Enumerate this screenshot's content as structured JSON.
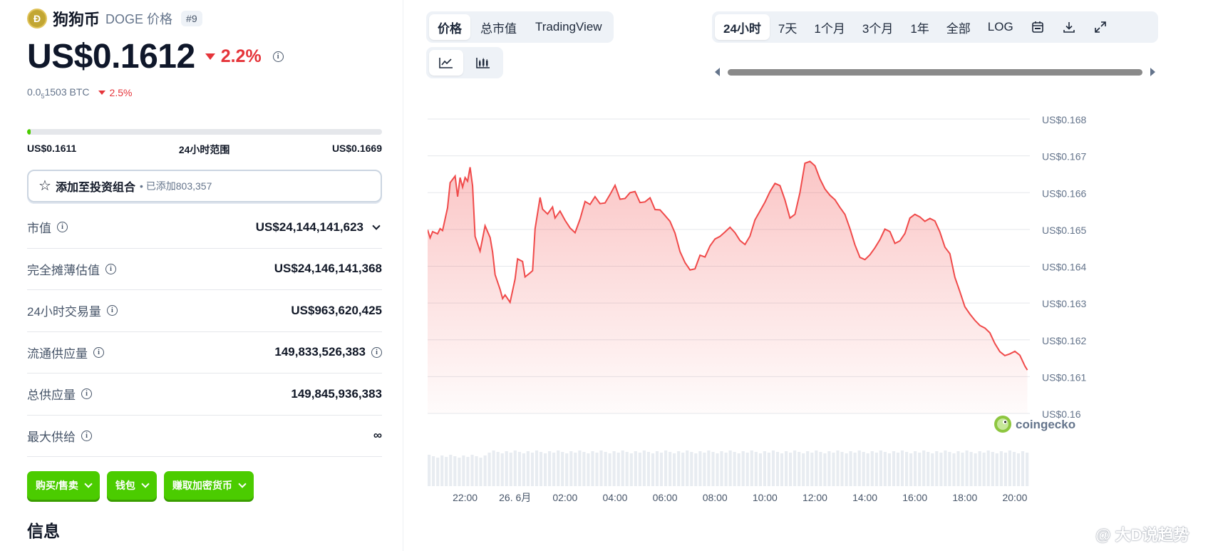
{
  "coin": {
    "name": "狗狗币",
    "symbol_label": "DOGE 价格",
    "rank": "#9",
    "price": "US$0.1612",
    "change_24h": "2.2%",
    "btc_prefix": "0.0",
    "btc_sub": "5",
    "btc_rest": "1503 BTC",
    "btc_change": "2.5%",
    "accent_color": "#4bcc00",
    "down_color": "#e5343a"
  },
  "range": {
    "low": "US$0.1611",
    "label": "24小时范围",
    "high": "US$0.1669",
    "position_fraction": 0.01
  },
  "portfolio": {
    "label": "添加至投资组合",
    "sub": "• 已添加803,357"
  },
  "stats": [
    {
      "label": "市值",
      "value": "US$24,144,141,623"
    },
    {
      "label": "完全摊薄估值",
      "value": "US$24,146,141,368"
    },
    {
      "label": "24小时交易量",
      "value": "US$963,620,425"
    },
    {
      "label": "流通供应量",
      "value": "149,833,526,383"
    },
    {
      "label": "总供应量",
      "value": "149,845,936,383"
    },
    {
      "label": "最大供给",
      "value": "∞"
    }
  ],
  "actions": [
    {
      "label": "购买/售卖"
    },
    {
      "label": "钱包"
    },
    {
      "label": "赚取加密货币"
    }
  ],
  "section_title": "信息",
  "view_tabs": [
    {
      "label": "价格",
      "active": true
    },
    {
      "label": "总市值",
      "active": false
    },
    {
      "label": "TradingView",
      "active": false
    }
  ],
  "chart_type_icons": [
    "line-chart-icon",
    "candlestick-chart-icon"
  ],
  "range_tabs": [
    {
      "label": "24小时",
      "active": true
    },
    {
      "label": "7天",
      "active": false
    },
    {
      "label": "1个月",
      "active": false
    },
    {
      "label": "3个月",
      "active": false
    },
    {
      "label": "1年",
      "active": false
    },
    {
      "label": "全部",
      "active": false
    },
    {
      "label": "LOG",
      "active": false
    }
  ],
  "toolbar_icons": [
    "calendar-icon",
    "download-icon",
    "fullscreen-icon"
  ],
  "watermark": "@ 大D说趋势",
  "chart_data": {
    "type": "area",
    "line_color": "#f04a4a",
    "brand_label": "coingecko",
    "y_ticks": [
      "US$0.168",
      "US$0.167",
      "US$0.166",
      "US$0.165",
      "US$0.164",
      "US$0.163",
      "US$0.162",
      "US$0.161",
      "US$0.16"
    ],
    "ylim": [
      0.16,
      0.168
    ],
    "x_ticks": [
      "22:00",
      "26. 6月",
      "02:00",
      "04:00",
      "06:00",
      "08:00",
      "10:00",
      "12:00",
      "14:00",
      "16:00",
      "18:00",
      "20:00"
    ],
    "x_tick_hours": [
      22,
      24,
      26,
      28,
      30,
      32,
      34,
      36,
      38,
      40,
      42,
      44
    ],
    "xlim_hours": [
      20.5,
      44.6
    ],
    "grid": true,
    "series": [
      {
        "x_hours": [
          20.5,
          20.6,
          20.7,
          20.9,
          21.0,
          21.1,
          21.3,
          21.4,
          21.6,
          21.7,
          21.8,
          21.9,
          22.0,
          22.1,
          22.2,
          22.3,
          22.4,
          22.6,
          22.7,
          22.8,
          23.0,
          23.1,
          23.2,
          23.4,
          23.5,
          23.6,
          23.8,
          24.0,
          24.1,
          24.3,
          24.4,
          24.6,
          24.7,
          24.8,
          25.0,
          25.1,
          25.3,
          25.5,
          25.6,
          25.8,
          26.0,
          26.2,
          26.4,
          26.6,
          26.8,
          27.0,
          27.2,
          27.4,
          27.6,
          27.8,
          28.0,
          28.2,
          28.4,
          28.6,
          28.8,
          29.0,
          29.2,
          29.4,
          29.6,
          29.8,
          30.0,
          30.2,
          30.4,
          30.6,
          30.8,
          31.0,
          31.2,
          31.4,
          31.6,
          31.8,
          32.0,
          32.2,
          32.4,
          32.6,
          32.8,
          33.0,
          33.2,
          33.4,
          33.6,
          33.8,
          34.0,
          34.2,
          34.4,
          34.6,
          34.8,
          35.0,
          35.2,
          35.4,
          35.6,
          35.8,
          36.0,
          36.2,
          36.4,
          36.6,
          36.8,
          37.0,
          37.2,
          37.4,
          37.6,
          37.8,
          38.0,
          38.2,
          38.4,
          38.6,
          38.8,
          39.0,
          39.2,
          39.4,
          39.6,
          39.8,
          40.0,
          40.2,
          40.4,
          40.6,
          40.8,
          41.0,
          41.2,
          41.4,
          41.6,
          41.8,
          42.0,
          42.2,
          42.4,
          42.6,
          42.8,
          43.0,
          43.2,
          43.4,
          43.6,
          43.8,
          44.0,
          44.2,
          44.4,
          44.5
        ],
        "values": [
          0.16499,
          0.16477,
          0.16494,
          0.16488,
          0.16502,
          0.16497,
          0.16559,
          0.16627,
          0.16645,
          0.16589,
          0.16641,
          0.16615,
          0.16641,
          0.16631,
          0.16669,
          0.16618,
          0.16481,
          0.16441,
          0.16475,
          0.1651,
          0.16478,
          0.16438,
          0.16377,
          0.16337,
          0.16312,
          0.16322,
          0.16302,
          0.16365,
          0.1642,
          0.16413,
          0.16371,
          0.16382,
          0.16388,
          0.16502,
          0.16587,
          0.16555,
          0.16542,
          0.16561,
          0.16531,
          0.1655,
          0.16525,
          0.16504,
          0.16491,
          0.16528,
          0.16576,
          0.16568,
          0.16589,
          0.1657,
          0.16572,
          0.16595,
          0.1662,
          0.16582,
          0.16584,
          0.166,
          0.16603,
          0.16573,
          0.16575,
          0.16586,
          0.16554,
          0.16553,
          0.16538,
          0.16522,
          0.1649,
          0.1644,
          0.1641,
          0.1639,
          0.16393,
          0.1643,
          0.16425,
          0.16455,
          0.16474,
          0.16481,
          0.16493,
          0.16506,
          0.16491,
          0.1647,
          0.16459,
          0.16482,
          0.16526,
          0.1655,
          0.16574,
          0.16603,
          0.16625,
          0.16619,
          0.1658,
          0.16531,
          0.16541,
          0.166,
          0.1668,
          0.16685,
          0.16673,
          0.16637,
          0.1661,
          0.16593,
          0.16581,
          0.1656,
          0.16541,
          0.16502,
          0.16458,
          0.16424,
          0.16418,
          0.16431,
          0.1645,
          0.16472,
          0.16501,
          0.16494,
          0.16462,
          0.16469,
          0.16489,
          0.16531,
          0.16541,
          0.16534,
          0.16522,
          0.1653,
          0.16523,
          0.16493,
          0.16452,
          0.16434,
          0.1637,
          0.16331,
          0.1629,
          0.1627,
          0.16253,
          0.16239,
          0.16232,
          0.16219,
          0.1619,
          0.16168,
          0.16157,
          0.16162,
          0.16169,
          0.16158,
          0.16129,
          0.16118
        ]
      }
    ],
    "volume_bars": 140
  }
}
